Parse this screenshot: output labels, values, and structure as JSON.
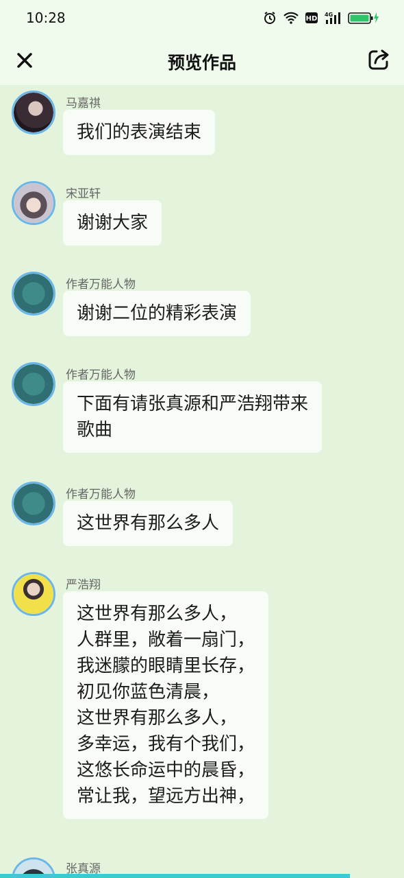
{
  "status": {
    "time": "10:28",
    "icons": [
      "alarm-icon",
      "wifi-icon",
      "hd-icon",
      "signal-4g-icon",
      "battery-icon"
    ]
  },
  "header": {
    "title": "预览作品",
    "close_icon": "close-icon",
    "share_icon": "share-icon"
  },
  "messages": [
    {
      "sender": "马嘉祺",
      "text": "我们的表演结束",
      "avatar": "avatar-majiaqi"
    },
    {
      "sender": "宋亚轩",
      "text": "谢谢大家",
      "avatar": "avatar-songyaxuan"
    },
    {
      "sender": "作者万能人物",
      "text": "谢谢二位的精彩表演",
      "avatar": "avatar-author"
    },
    {
      "sender": "作者万能人物",
      "text": "下面有请张真源和严浩翔带来\n歌曲",
      "avatar": "avatar-author"
    },
    {
      "sender": "作者万能人物",
      "text": "这世界有那么多人",
      "avatar": "avatar-author"
    },
    {
      "sender": "严浩翔",
      "text": "这世界有那么多人，\n人群里，敞着一扇门，\n我迷朦的眼睛里长存，\n初见你蓝色清晨，\n这世界有那么多人，\n多幸运，我有个我们，\n这悠长命运中的晨昏，\n常让我，望远方出神，",
      "avatar": "avatar-yanhaoxiang"
    },
    {
      "sender": "张真源",
      "text": "",
      "avatar": "avatar-zhangzhenyuan"
    }
  ],
  "colors": {
    "background": "#e3f3dc",
    "bubble": "#f7fdf6",
    "avatar_border": "#6bb6e6",
    "battery": "#2ec46a"
  }
}
